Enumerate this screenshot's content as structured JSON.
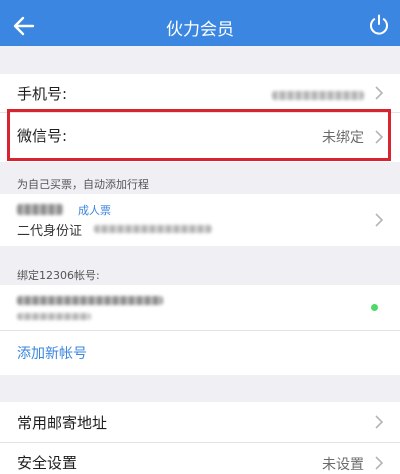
{
  "nav": {
    "title": "伙力会员"
  },
  "account": {
    "phone_label": "手机号:",
    "wechat_label": "微信号:",
    "wechat_value": "未绑定"
  },
  "passenger": {
    "caption": "为自己买票，自动添加行程",
    "ticket_type": "成人票",
    "id_type": "二代身份证"
  },
  "bind12306": {
    "caption": "绑定12306帐号:",
    "add_link": "添加新帐号",
    "status_color": "#4cd964"
  },
  "settings": {
    "address_label": "常用邮寄地址",
    "security_label": "安全设置",
    "security_value": "未设置"
  },
  "colors": {
    "accent": "#3a86e0",
    "highlight": "#d8242e"
  }
}
